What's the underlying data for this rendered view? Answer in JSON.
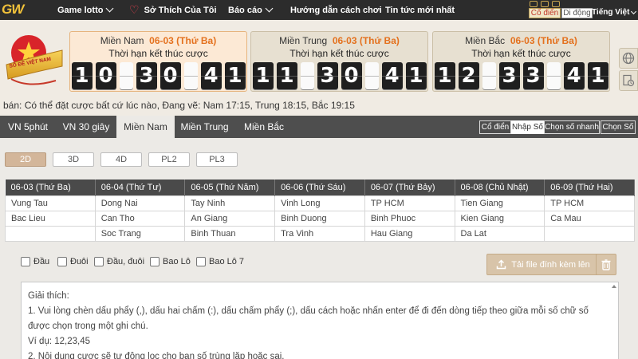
{
  "logo": {
    "text": "GW"
  },
  "nav": [
    {
      "label": "Game lotto",
      "has_dropdown": true
    },
    {
      "label": "Sở Thích Của Tôi",
      "icon": "heart-icon"
    },
    {
      "label": "Báo cáo",
      "has_dropdown": true
    },
    {
      "label": "Hướng dẫn cách chơi"
    },
    {
      "label": "Tin tức mới nhất"
    }
  ],
  "topright": {
    "view_classic": "Cổ điển",
    "view_mobile": "Di động",
    "language": "Tiếng Việt"
  },
  "badge": {
    "text": "SỐ ĐỀ VIỆT NAM"
  },
  "countdowns": [
    {
      "region": "Miền Nam",
      "date": "06-03 (Thứ Ba)",
      "subtitle": "Thời hạn kết thúc cược",
      "digits": [
        "1",
        "0",
        "3",
        "0",
        "4",
        "1"
      ]
    },
    {
      "region": "Miền Trung",
      "date": "06-03 (Thứ Ba)",
      "subtitle": "Thời hạn kết thúc cược",
      "digits": [
        "1",
        "1",
        "3",
        "0",
        "4",
        "1"
      ]
    },
    {
      "region": "Miền Bắc",
      "date": "06-03 (Thứ Ba)",
      "subtitle": "Thời hạn kết thúc cược",
      "digits": [
        "1",
        "2",
        "3",
        "3",
        "4",
        "1"
      ]
    }
  ],
  "info_text": "bán: Có thể đặt cược bất cứ lúc nào,   Đang vẽ: Nam 17:15, Trung 18:15, Bắc 19:15",
  "region_tabs": [
    "VN 5phút",
    "VN 30 giây",
    "Miền Nam",
    "Miền Trung",
    "Miền Bắc"
  ],
  "active_region": "Miền Nam",
  "mode_buttons": [
    "Cổ điển",
    "Nhập Số",
    "Chọn số nhanh",
    "Chọn Số"
  ],
  "active_mode": "Nhập Số",
  "game_tabs": [
    "2D",
    "3D",
    "4D",
    "PL2",
    "PL3"
  ],
  "active_game": "2D",
  "schedule": {
    "headers": [
      "06-03 (Thứ Ba)",
      "06-04 (Thứ Tư)",
      "06-05 (Thứ Năm)",
      "06-06 (Thứ Sáu)",
      "06-07 (Thứ Bảy)",
      "06-08 (Chủ Nhật)",
      "06-09 (Thứ Hai)"
    ],
    "rows": [
      [
        "Vung Tau",
        "Dong Nai",
        "Tay Ninh",
        "Vinh Long",
        "TP HCM",
        "Tien Giang",
        "TP HCM"
      ],
      [
        "Bac Lieu",
        "Can Tho",
        "An Giang",
        "Binh Duong",
        "Binh Phuoc",
        "Kien Giang",
        "Ca Mau"
      ],
      [
        "",
        "Soc Trang",
        "Binh Thuan",
        "Tra Vinh",
        "Hau Giang",
        "Da Lat",
        ""
      ]
    ]
  },
  "options": [
    "Đầu",
    "Đuôi",
    "Đầu, đuôi",
    "Bao Lô",
    "Bao Lô 7"
  ],
  "upload_label": "Tải file đính kèm lên",
  "explain": {
    "title": "Giải thích:",
    "line1": "1. Vui lòng chèn dấu phẩy (,), dấu hai chấm (:), dấu chấm phẩy (;), dấu cách hoặc nhấn enter để đi đến dòng tiếp theo giữa mỗi số chữ số được chọn trong một ghi chú.",
    "example": "Ví dụ: 12,23,45",
    "line2": "2. Nội dung cược sẽ tự động lọc cho bạn số trùng lặp hoặc sai."
  }
}
